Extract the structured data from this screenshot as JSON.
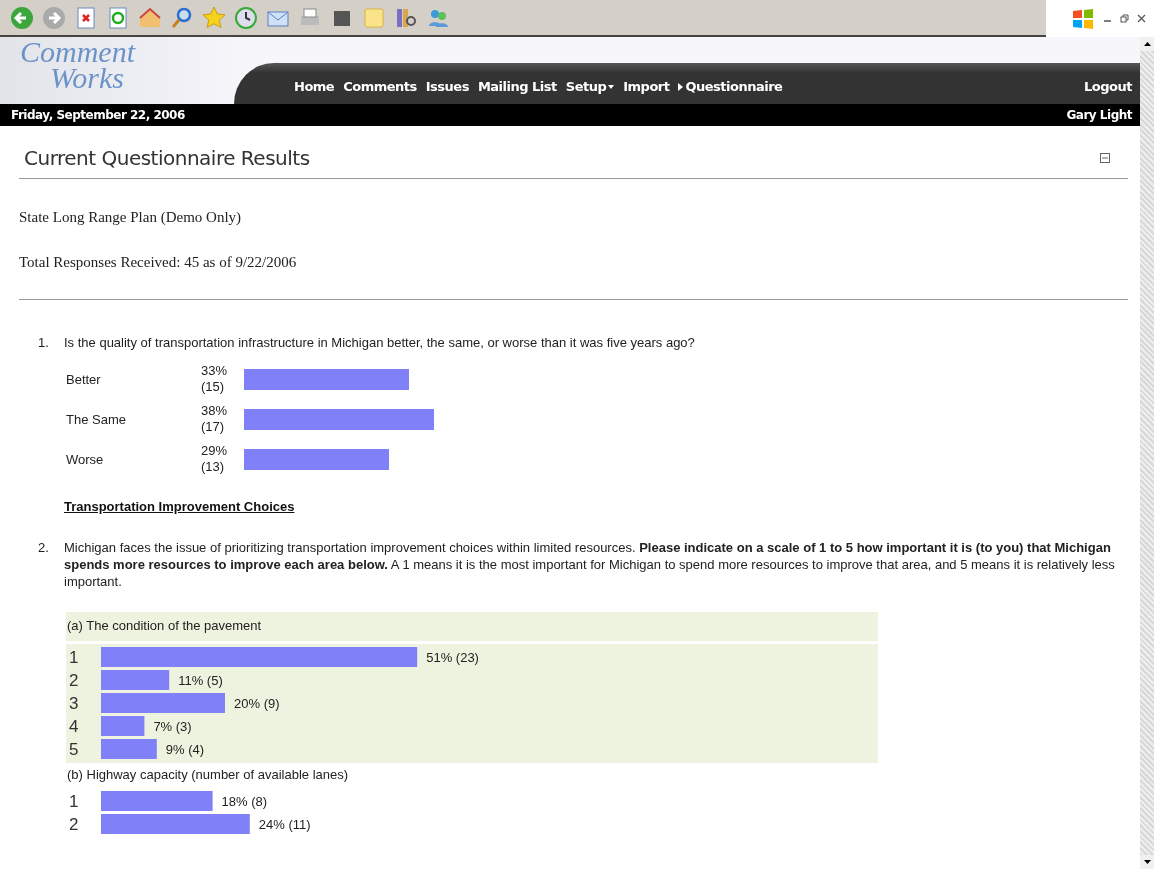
{
  "header": {
    "logo_line_1": "Comment",
    "logo_line_2": "Works",
    "nav": [
      {
        "label": "Home",
        "kind": "plain"
      },
      {
        "label": "Comments",
        "kind": "plain"
      },
      {
        "label": "Issues",
        "kind": "plain"
      },
      {
        "label": "Mailing List",
        "kind": "plain"
      },
      {
        "label": "Setup",
        "kind": "dropdown"
      },
      {
        "label": "Import",
        "kind": "plain"
      },
      {
        "label": "Questionnaire",
        "kind": "current"
      }
    ],
    "logout": "Logout",
    "date": "Friday, September 22, 2006",
    "user": "Gary Light"
  },
  "page": {
    "title": "Current Questionnaire Results",
    "survey": "State Long Range Plan (Demo Only)",
    "total": "Total Responses Received: 45 as of 9/22/2006"
  },
  "questions": [
    {
      "kind": "simple",
      "number": "1.",
      "text": "Is the quality of transportation infrastructure in Michigan better, the same, or worse than it was five years ago?",
      "chart_data": {
        "type": "bar",
        "orientation": "horizontal",
        "categories": [
          "Better",
          "The Same",
          "Worse"
        ],
        "values": [
          33,
          38,
          29
        ],
        "value_labels": [
          "33% (15)",
          "38% (17)",
          "29% (13)"
        ]
      }
    },
    {
      "kind": "section",
      "text": "Transportation Improvement Choices"
    },
    {
      "kind": "grid",
      "number": "2.",
      "text": "Michigan faces the issue of prioritizing transportation improvement choices within limited resources. **Please indicate on a scale of 1 to 5 how important it is (to you) that Michigan spends more resources to improve each area below.** A 1 means it is the most important for Michigan to spend more resources to improve that area, and 5 means it is relatively less important.",
      "items": [
        {
          "label": "(a) The condition of the pavement",
          "highlighted": true,
          "chart_data": {
            "type": "bar",
            "orientation": "horizontal",
            "categories": [
              "1",
              "2",
              "3",
              "4",
              "5"
            ],
            "values": [
              51,
              11,
              20,
              7,
              9
            ],
            "value_labels": [
              "51% (23)",
              "11% (5)",
              "20% (9)",
              "7% (3)",
              "9% (4)"
            ]
          }
        },
        {
          "label": "(b) Highway capacity (number of available lanes)",
          "highlighted": false,
          "chart_data": {
            "type": "bar",
            "orientation": "horizontal",
            "categories": [
              "1",
              "2"
            ],
            "values": [
              18,
              24
            ],
            "value_labels": [
              "18% (8)",
              "24% (11)"
            ]
          }
        }
      ]
    }
  ]
}
